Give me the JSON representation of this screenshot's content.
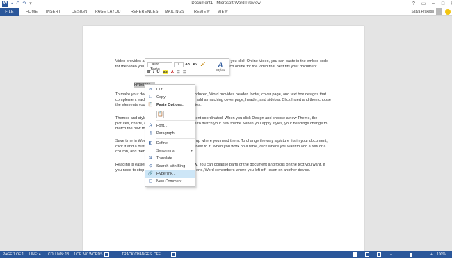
{
  "title": "Document1 - Microsoft Word Preview",
  "qat": {
    "word_icon": "word-logo-icon",
    "save_icon": "save-icon",
    "undo_icon": "undo-icon",
    "redo_icon": "redo-icon",
    "customize_icon": "customize-icon"
  },
  "window": {
    "help": "?",
    "ribbon_options": "▭",
    "minimize": "–",
    "restore": "□",
    "close": "✕"
  },
  "tabs": [
    "FILE",
    "HOME",
    "INSERT",
    "DESIGN",
    "PAGE LAYOUT",
    "REFERENCES",
    "MAILINGS",
    "REVIEW",
    "VIEW"
  ],
  "user": {
    "name": "Satya Prakash"
  },
  "document": {
    "paragraphs": [
      "Video provides a powerful way to help you prove your point. When you click Online Video, you can paste in the embed code for the video you want to add. You can also type a keyword to search online for the video that best fits your document.",
      "To make your document look professionally produced, Word provides header, footer, cover page, and text box designs that complement each other. For example, you can add a matching cover page, header, and sidebar. Click Insert and then choose the elements you want from the different galleries.",
      "Themes and styles also help keep your document coordinated. When you click Design and choose a new Theme, the pictures, charts, and SmartArt graphics change to match your new theme. When you apply styles, your headings change to match the new theme.",
      "Save time in Word with new buttons that show up where you need them. To change the way a picture fits in your document, click it and a button for layout options appears next to it. When you work on a table, click where you want to add a row or a column, and then click the plus sign.",
      "Reading is easier, too, in the new Reading view. You can collapse parts of the document and focus on the text you want. If you need to stop reading before you reach the end, Word remembers where you left off - even on another device."
    ],
    "selected_word": "Hyperlink"
  },
  "mini_toolbar": {
    "font": "Calibri (Body)",
    "size": "11",
    "grow": "A˄",
    "shrink": "A˅",
    "format_painter": "🖌",
    "styles_glyph": "A",
    "styles_label": "Styles",
    "bold": "B",
    "italic": "I",
    "underline": "U",
    "highlight": "ab",
    "font_color": "A",
    "bullets": "☰",
    "numbering": "☰"
  },
  "context_menu": {
    "items": [
      {
        "label": "Cut",
        "icon": "✂"
      },
      {
        "label": "Copy",
        "icon": "❐"
      },
      {
        "label": "Paste Options:",
        "icon": "📋"
      },
      {
        "label": "Font...",
        "icon": "A"
      },
      {
        "label": "Paragraph...",
        "icon": "¶"
      },
      {
        "label": "Define",
        "icon": "◧"
      },
      {
        "label": "Synonyms",
        "icon": ""
      },
      {
        "label": "Translate",
        "icon": "⌘"
      },
      {
        "label": "Search with Bing",
        "icon": "⊙"
      },
      {
        "label": "Hyperlink...",
        "icon": "🔗"
      },
      {
        "label": "New Comment",
        "icon": "▢"
      }
    ],
    "paste_keep_text_icon": "📋",
    "submenu_arrow": "▸"
  },
  "status_bar": {
    "page": "PAGE 1 OF 1",
    "line": "LINE: 4",
    "column": "COLUMN: 18",
    "words": "1 OF 240 WORDS",
    "track_changes": "TRACK CHANGES: OFF",
    "zoom": "100%",
    "zoom_minus": "–",
    "zoom_plus": "+"
  },
  "colors": {
    "accent": "#2b579a",
    "highlight": "#cde6f7",
    "selection": "#c9c9c9"
  }
}
